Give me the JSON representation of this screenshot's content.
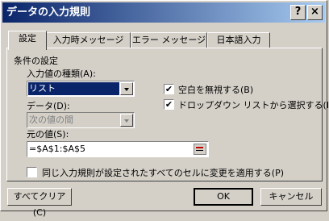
{
  "window": {
    "title": "データの入力規則",
    "help_glyph": "?",
    "close_glyph": "×"
  },
  "tabs": [
    {
      "label": "設定"
    },
    {
      "label": "入力時メッセージ"
    },
    {
      "label": "エラー メッセージ"
    },
    {
      "label": "日本語入力"
    }
  ],
  "settings": {
    "group_label": "条件の設定",
    "allow_label": "入力値の種類(A):",
    "allow_value": "リスト",
    "data_label": "データ(D):",
    "data_value": "次の値の間",
    "source_label": "元の値(S):",
    "source_value": "=$A$1:$A$5",
    "ignore_blank_label": "空白を無視する(B)",
    "ignore_blank_checked": true,
    "dropdown_label": "ドロップダウン リストから選択する(I)",
    "dropdown_checked": true,
    "apply_all_label": "同じ入力規則が設定されたすべてのセルに変更を適用する(P)",
    "apply_all_checked": false,
    "check_glyph": "✔"
  },
  "footer": {
    "clear_all_label": "すべてクリア(C)",
    "ok_label": "OK",
    "cancel_label": "キャンセル"
  }
}
